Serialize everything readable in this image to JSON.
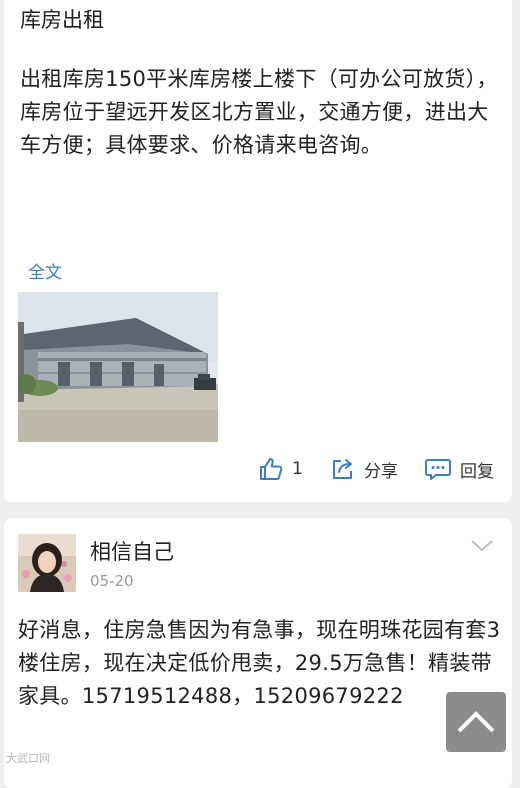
{
  "post1": {
    "title": "库房出租",
    "body": "出租库房150平米库房楼上楼下（可办公可放货），库房位于望远开发区北方置业，交通方便，进出大车方便；具体要求、价格请来电咨询。",
    "full_text_link": "全文",
    "actions": {
      "like_count": "1",
      "share_label": "分享",
      "reply_label": "回复"
    }
  },
  "post2": {
    "user_name": "相信自己",
    "date": "05-20",
    "body": "好消息，住房急售因为有急事，现在明珠花园有套3楼住房，现在决定低价甩卖，29.5万急售！精装带家具。15719512488，15209679222"
  },
  "watermark": "大武口网",
  "colors": {
    "accent_link": "#3a7fc4",
    "icon_blue": "#3b7ec2",
    "background": "#efefef"
  }
}
